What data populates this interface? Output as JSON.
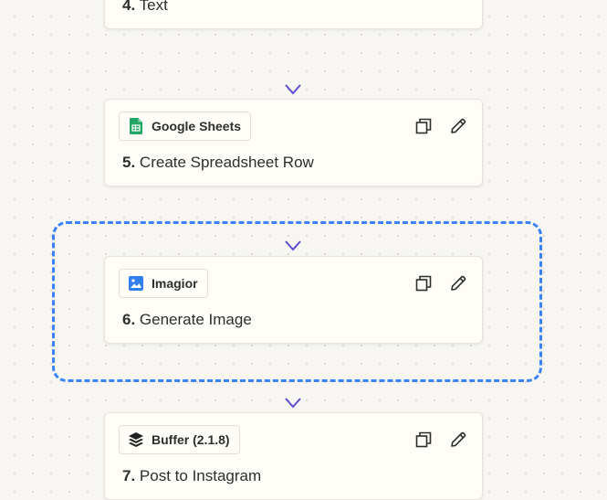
{
  "steps": [
    {
      "number": "4.",
      "title": "Text",
      "app": ""
    },
    {
      "number": "5.",
      "title": "Create Spreadsheet Row",
      "app": "Google Sheets",
      "icon": "google-sheets-icon",
      "icon_color": "#23a566"
    },
    {
      "number": "6.",
      "title": "Generate Image",
      "app": "Imagior",
      "icon": "image-icon",
      "icon_color": "#2f80ed"
    },
    {
      "number": "7.",
      "title": "Post to Instagram",
      "app": "Buffer (2.1.8)",
      "icon": "buffer-icon",
      "icon_color": "#222222"
    }
  ],
  "colors": {
    "connector": "#5b4fcf",
    "selection": "#3b82f6",
    "card_bg": "#fffdf8",
    "canvas_bg": "#f7f6f2"
  }
}
